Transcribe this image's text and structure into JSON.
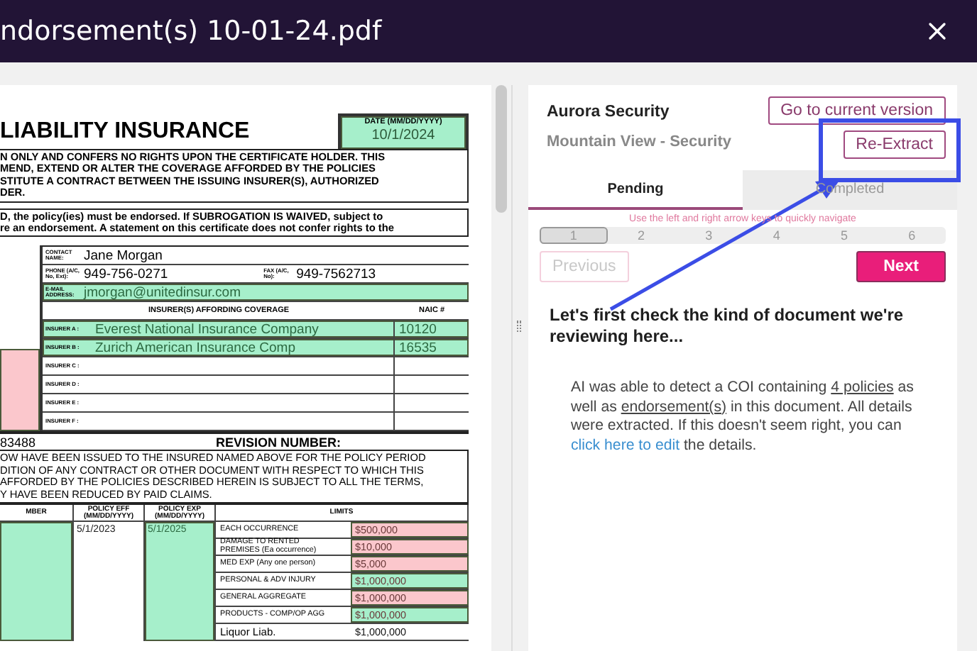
{
  "header": {
    "title": "ndorsement(s) 10-01-24.pdf"
  },
  "document": {
    "title": "LIABILITY INSURANCE",
    "date": {
      "label": "DATE (MM/DD/YYYY)",
      "value": "10/1/2024",
      "color": "#a6efcb"
    },
    "notice_lines": [
      "N ONLY AND CONFERS NO RIGHTS UPON THE CERTIFICATE HOLDER. THIS",
      "MEND, EXTEND OR ALTER THE COVERAGE AFFORDED BY THE POLICIES",
      "STITUTE A CONTRACT BETWEEN THE ISSUING INSURER(S), AUTHORIZED",
      "DER."
    ],
    "subrogation_lines": [
      "D, the policy(ies) must be endorsed.  If SUBROGATION IS WAIVED, subject to",
      "re an endorsement.  A statement on this certificate does not confer rights to the"
    ],
    "left_block": {
      "color": "#fbc7cc"
    },
    "contact_name": {
      "label": "CONTACT NAME:",
      "value": "Jane Morgan"
    },
    "phone": {
      "label": "PHONE (A/C, No, Ext):",
      "value": "949-756-0271"
    },
    "fax": {
      "label": "FAX (A/C, No):",
      "value": "949-7562713"
    },
    "email": {
      "label": "E-MAIL ADDRESS:",
      "value": "jmorgan@unitedinsur.com",
      "color": "#a6efcb"
    },
    "insurers": {
      "heading": "INSURER(S) AFFORDING COVERAGE",
      "naic_heading": "NAIC #",
      "rows": [
        {
          "label": "INSURER A :",
          "name": "Everest National Insurance Company",
          "naic": "10120",
          "color": "#a6efcb"
        },
        {
          "label": "INSURER B :",
          "name": "Zurich American Insurance Comp",
          "naic": "16535",
          "color": "#a6efcb"
        },
        {
          "label": "INSURER C :"
        },
        {
          "label": "INSURER D :"
        },
        {
          "label": "INSURER E :"
        },
        {
          "label": "INSURER F :"
        }
      ]
    },
    "certificate_number": "83488",
    "revision_label": "REVISION NUMBER:",
    "coverage_lines": [
      "OW HAVE BEEN ISSUED TO THE INSURED NAMED ABOVE FOR THE POLICY PERIOD",
      "DITION OF ANY CONTRACT OR OTHER DOCUMENT WITH RESPECT TO WHICH THIS",
      "AFFORDED BY THE POLICIES DESCRIBED HEREIN IS SUBJECT TO ALL THE TERMS,",
      "Y HAVE BEEN REDUCED BY PAID CLAIMS."
    ],
    "coverage_table": {
      "columns": [
        "MBER",
        "POLICY EFF (MM/DD/YYYY)",
        "POLICY EXP (MM/DD/YYYY)",
        "LIMITS"
      ],
      "policy_number": {
        "color": "#a6efcb"
      },
      "policy_eff": {
        "value": "5/1/2023"
      },
      "policy_exp": {
        "value": "5/1/2025",
        "color": "#a6efcb"
      },
      "limits": [
        {
          "label": "EACH OCCURRENCE",
          "value": "$500,000",
          "color": "#fbc7cc"
        },
        {
          "label": "DAMAGE TO RENTED PREMISES (Ea occurrence)",
          "value": "$10,000",
          "color": "#fbc7cc"
        },
        {
          "label": "MED EXP (Any one person)",
          "value": "$5,000",
          "color": "#fbc7cc"
        },
        {
          "label": "PERSONAL & ADV INJURY",
          "value": "$1,000,000",
          "color": "#a6efcb"
        },
        {
          "label": "GENERAL AGGREGATE",
          "value": "$1,000,000",
          "color": "#fbc7cc"
        },
        {
          "label": "PRODUCTS - COMP/OP AGG",
          "value": "$1,000,000",
          "color": "#a6efcb"
        },
        {
          "label": "Liquor Liab.",
          "value": "$1,000,000"
        }
      ]
    }
  },
  "panel": {
    "company": "Aurora Security",
    "location": "Mountain View - Security",
    "buttons": [
      {
        "label": "Go to current version"
      },
      {
        "label": "Re-Extract"
      }
    ],
    "tabs": [
      {
        "label": "Pending",
        "selected": true
      },
      {
        "label": "Completed",
        "selected": false
      }
    ],
    "hint": "Use the left and right arrow keys to quickly navigate",
    "steps": [
      {
        "label": "1",
        "selected": true
      },
      {
        "label": "2",
        "selected": false
      },
      {
        "label": "3",
        "selected": false
      },
      {
        "label": "4",
        "selected": false
      },
      {
        "label": "5",
        "selected": false
      },
      {
        "label": "6",
        "selected": false
      }
    ],
    "previous": {
      "label": "Previous",
      "disabled": true
    },
    "next": {
      "label": "Next",
      "disabled": false
    },
    "heading": "Let's first check the kind of document we're reviewing here...",
    "message": [
      {
        "text": "AI was able to detect a COI containing ",
        "kind": "plain"
      },
      {
        "text": "4 policies",
        "kind": "underlined"
      },
      {
        "text": " as well as ",
        "kind": "plain"
      },
      {
        "text": "endorsement(s)",
        "kind": "underlined"
      },
      {
        "text": " in this document. All details were extracted. If this doesn't seem right, you can ",
        "kind": "plain"
      },
      {
        "text": "click here to edit",
        "kind": "link"
      },
      {
        "text": " the details.",
        "kind": "plain"
      }
    ]
  }
}
